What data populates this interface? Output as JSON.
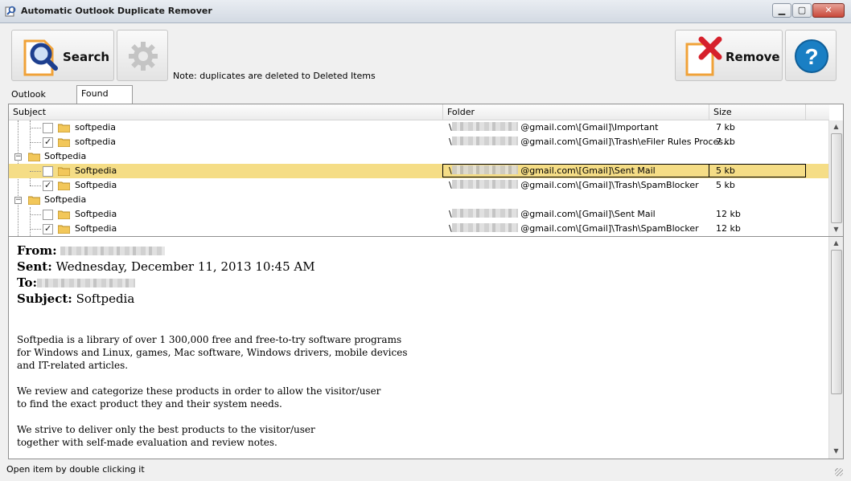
{
  "window": {
    "title": "Automatic Outlook Duplicate Remover"
  },
  "toolbar": {
    "search_label": "Search",
    "remove_label": "Remove",
    "note": "Note: duplicates are deleted to Deleted Items"
  },
  "tabs": [
    {
      "label": "Outlook Folders",
      "active": false
    },
    {
      "label": "Found Duplicates",
      "active": true
    }
  ],
  "grid": {
    "columns": [
      "Subject",
      "Folder",
      "Size"
    ],
    "rows": [
      {
        "kind": "item",
        "checked": false,
        "subject": "softpedia",
        "folder": "@gmail.com\\[Gmail]\\Important",
        "size": "7 kb"
      },
      {
        "kind": "item",
        "checked": true,
        "subject": "softpedia",
        "folder": "@gmail.com\\[Gmail]\\Trash\\eFiler Rules Proces…",
        "size": "7 kb"
      },
      {
        "kind": "group",
        "subject": "Softpedia"
      },
      {
        "kind": "item",
        "checked": false,
        "subject": "Softpedia",
        "folder": "@gmail.com\\[Gmail]\\Sent Mail",
        "size": "5 kb",
        "selected": true
      },
      {
        "kind": "item",
        "checked": true,
        "subject": "Softpedia",
        "folder": "@gmail.com\\[Gmail]\\Trash\\SpamBlocker",
        "size": "5 kb"
      },
      {
        "kind": "group",
        "subject": "Softpedia"
      },
      {
        "kind": "item",
        "checked": false,
        "subject": "Softpedia",
        "folder": "@gmail.com\\[Gmail]\\Sent Mail",
        "size": "12 kb"
      },
      {
        "kind": "item",
        "checked": true,
        "subject": "Softpedia",
        "folder": "@gmail.com\\[Gmail]\\Trash\\SpamBlocker",
        "size": "12 kb"
      }
    ]
  },
  "preview": {
    "from_label": "From:",
    "sent_label": "Sent:",
    "sent_value": "Wednesday, December 11, 2013 10:45 AM",
    "to_label": "To:",
    "subject_label": "Subject:",
    "subject_value": "Softpedia",
    "body": [
      "Softpedia is a library of over 1 300,000 free and free-to-try software programs",
      "for Windows and Linux, games, Mac software, Windows drivers, mobile devices",
      "and IT-related articles.",
      "",
      "We review and categorize these products in order to allow the visitor/user",
      "to find the exact product they and their system needs.",
      "",
      "We strive to deliver only the best products to the visitor/user",
      "together with self-made evaluation and review notes."
    ]
  },
  "status": {
    "text": "Open item by double clicking it"
  },
  "colors": {
    "selection": "#f5dd86",
    "remove_x": "#d6202b",
    "help_blue": "#1a7fc4",
    "accent_orange": "#f0a238"
  }
}
